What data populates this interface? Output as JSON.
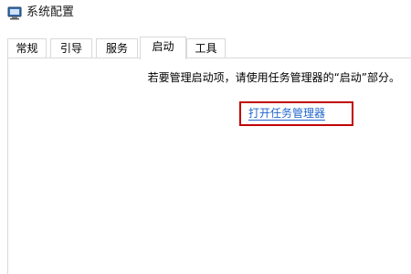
{
  "window": {
    "title": "系统配置",
    "icon": "system-config-icon"
  },
  "tabs": [
    {
      "label": "常规"
    },
    {
      "label": "引导"
    },
    {
      "label": "服务"
    },
    {
      "label": "启动"
    },
    {
      "label": "工具"
    }
  ],
  "startup": {
    "message": "若要管理启动项，请使用任务管理器的“启动”部分。",
    "open_task_manager_link": "打开任务管理器"
  },
  "colors": {
    "link": "#2266cc",
    "highlight": "#c00000",
    "border": "#d9d9d9"
  }
}
